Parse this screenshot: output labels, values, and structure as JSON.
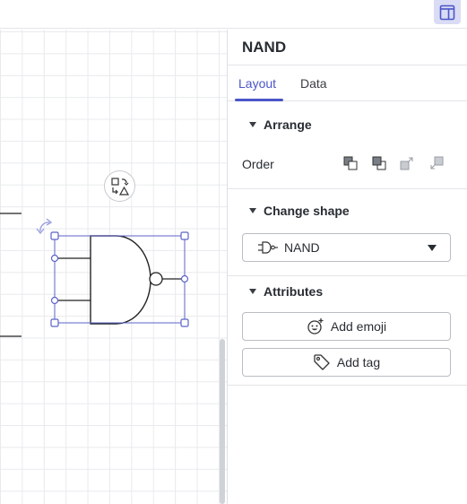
{
  "toolbar": {
    "panel_toggle_icon": "panel-layout-icon",
    "accent": "#4a56c8"
  },
  "canvas": {
    "shape": {
      "type": "NAND gate",
      "selection_color": "#5b63c9"
    },
    "swap_icon": "shape-swap-icon",
    "rotate_icon": "rotate-handle-icon"
  },
  "panel": {
    "title": "NAND",
    "tabs": [
      {
        "label": "Layout",
        "active": true
      },
      {
        "label": "Data",
        "active": false
      }
    ],
    "arrange": {
      "heading": "Arrange",
      "order_label": "Order",
      "order_buttons": [
        "bring-to-front-icon",
        "send-to-back-icon",
        "bring-forward-icon",
        "send-backward-icon"
      ]
    },
    "change_shape": {
      "heading": "Change shape",
      "selected": "NAND",
      "icon": "nand-gate-icon"
    },
    "attributes": {
      "heading": "Attributes",
      "add_emoji_label": "Add emoji",
      "add_tag_label": "Add tag"
    }
  }
}
